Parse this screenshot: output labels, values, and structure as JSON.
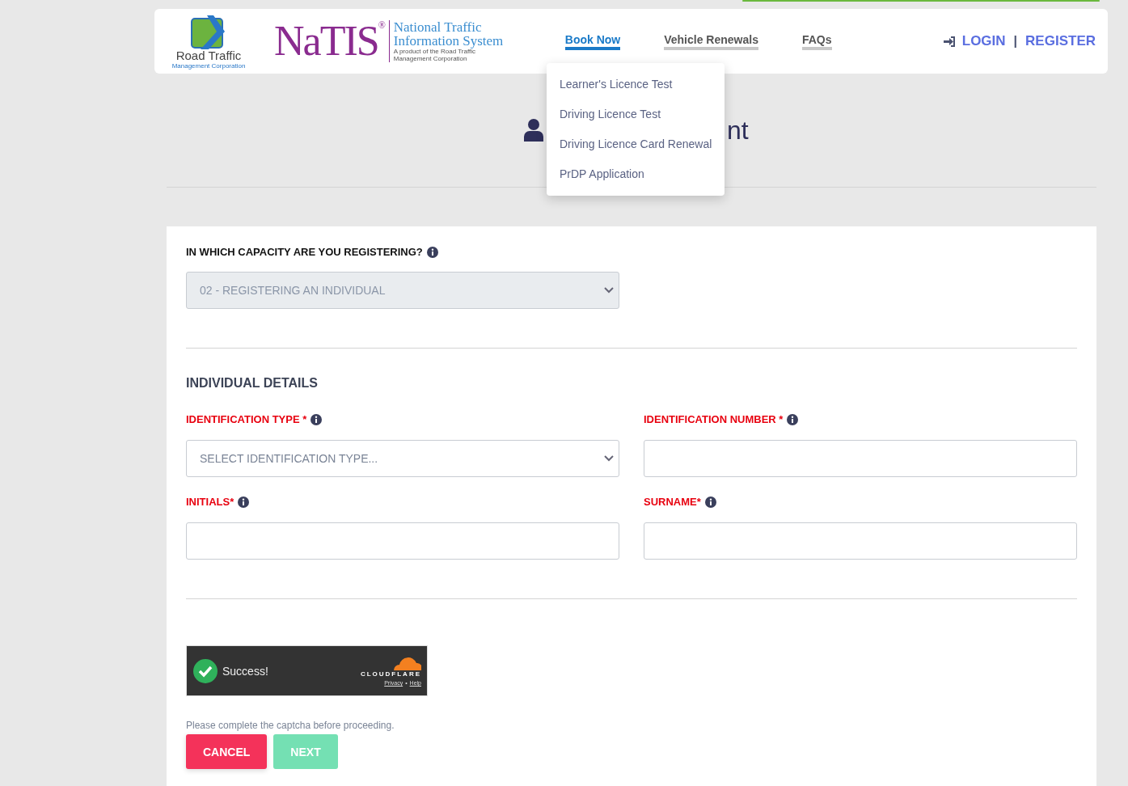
{
  "header": {
    "rtmc_logo": {
      "name": "Road Traffic",
      "sub": "Management Corporation"
    },
    "natis_logo": {
      "mark": "NaTIS",
      "reg": "®",
      "line1": "National Traffic",
      "line2": "Information System",
      "tagline": "A product of the Road Traffic Management Corporation"
    },
    "nav": [
      {
        "label": "Book Now",
        "selected": true
      },
      {
        "label": "Vehicle Renewals",
        "selected": false
      },
      {
        "label": "FAQs",
        "selected": false
      }
    ],
    "login": "LOGIN",
    "separator": "|",
    "register": "REGISTER"
  },
  "dropdown": [
    "Learner's Licence Test",
    "Driving Licence Test",
    "Driving Licence Card Renewal",
    "PrDP Application"
  ],
  "heading": {
    "visible_end": "nt"
  },
  "form": {
    "capacity": {
      "label": "IN WHICH CAPACITY ARE YOU REGISTERING?",
      "required": false,
      "value": "02 - REGISTERING AN INDIVIDUAL",
      "disabled": true
    },
    "section": "INDIVIDUAL DETAILS",
    "fields": [
      {
        "label": "IDENTIFICATION TYPE *",
        "required": true,
        "kind": "select",
        "placeholder": "SELECT IDENTIFICATION TYPE...",
        "disabled": false
      },
      {
        "label": "IDENTIFICATION NUMBER *",
        "required": true,
        "kind": "text",
        "disabled": false
      },
      {
        "label": "INITIALS*",
        "required": true,
        "kind": "text",
        "disabled": false
      },
      {
        "label": "SURNAME*",
        "required": true,
        "kind": "text",
        "disabled": false
      }
    ],
    "captcha": {
      "status": "Success!",
      "brand": "CLOUDFLARE",
      "privacy": "Privacy",
      "dot": "•",
      "help": "Help"
    },
    "note": "Please complete the captcha before proceeding.",
    "buttons": [
      {
        "label": "CANCEL",
        "kind": "cancel",
        "disabled": false
      },
      {
        "label": "NEXT",
        "kind": "next",
        "disabled": true
      }
    ]
  }
}
